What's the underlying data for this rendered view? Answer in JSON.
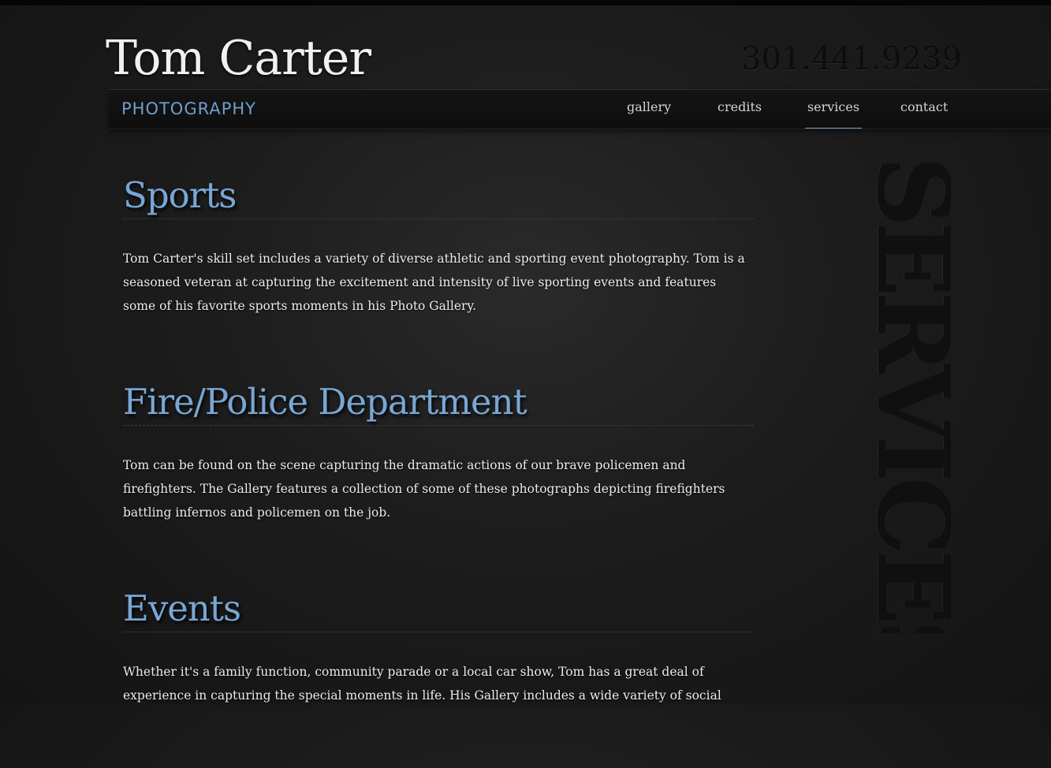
{
  "brand": {
    "name": "Tom Carter",
    "subtitle": "PHOTOGRAPHY",
    "phone": "301.441.9239"
  },
  "nav": {
    "items": [
      {
        "label": "gallery"
      },
      {
        "label": "credits"
      },
      {
        "label": "services"
      },
      {
        "label": "contact"
      }
    ],
    "active": "services"
  },
  "page": {
    "vertical_title": "SERVICES"
  },
  "sections": [
    {
      "title": "Sports",
      "text": "Tom Carter's skill set includes a variety of diverse athletic and sporting event photography. Tom is a seasoned veteran at capturing the excitement and intensity of live sporting events and features some of his favorite sports moments in his Photo Gallery."
    },
    {
      "title": "Fire/Police Department",
      "text": "Tom can be found on the scene capturing the dramatic actions of our brave policemen and firefighters. The Gallery features a collection of some of these photographs depicting firefighters battling infernos and policemen on the job."
    },
    {
      "title": "Events",
      "text": "Whether it's a family function, community parade or a local car show, Tom has a great deal of experience in capturing the special moments in life. His Gallery includes a wide variety of social"
    }
  ],
  "colors": {
    "accent": "#79a6d4",
    "background": "#1c1c1c",
    "text": "#ececec"
  }
}
